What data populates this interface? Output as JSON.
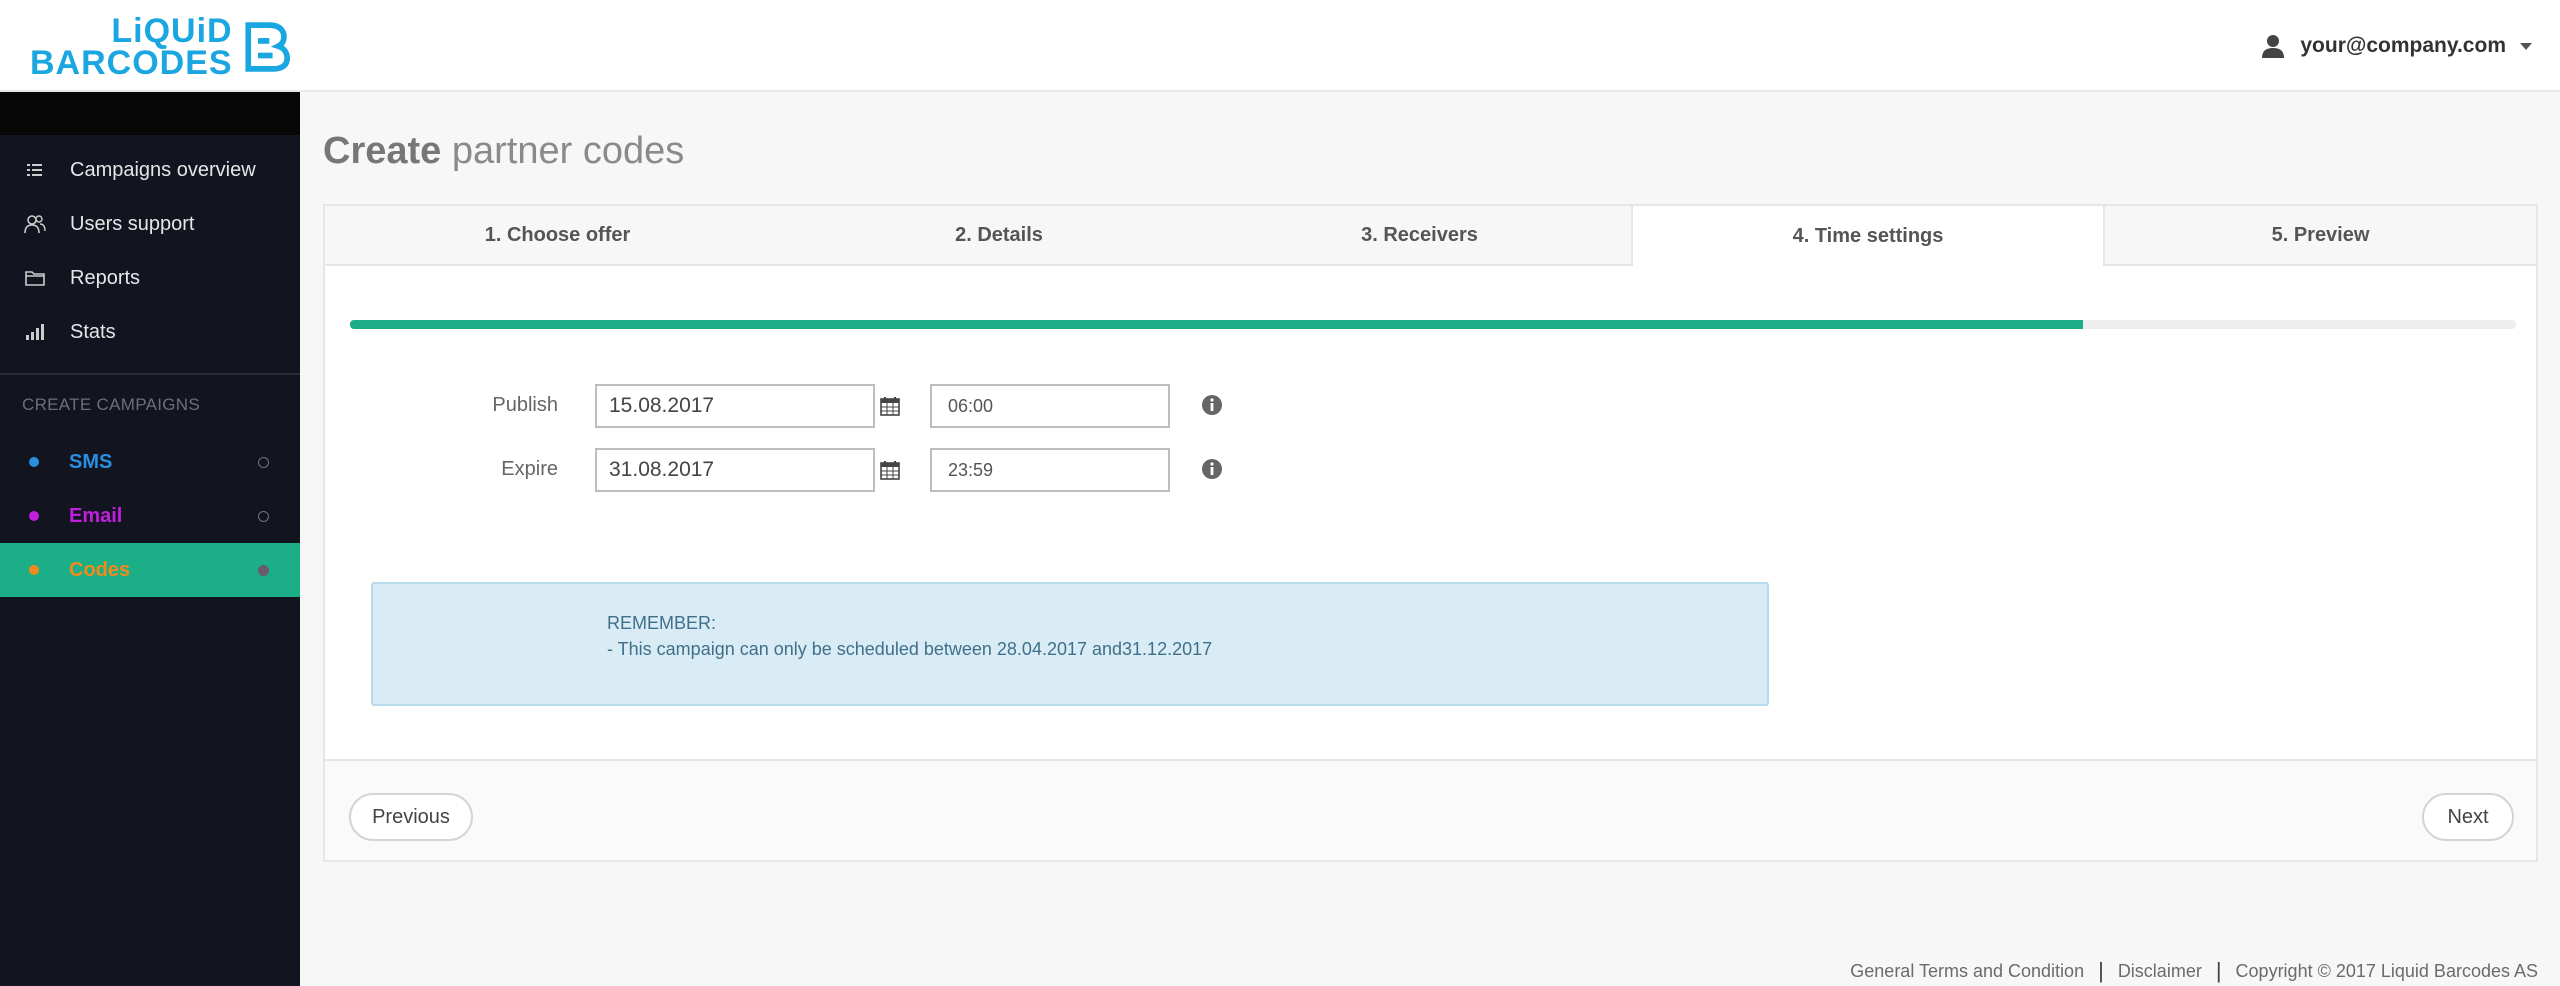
{
  "header": {
    "logo_line1": "LiQUiD",
    "logo_line2": "BARCODES",
    "user_email": "your@company.com",
    "brand_color": "#1aa6e0"
  },
  "sidebar": {
    "items": [
      {
        "label": "Campaigns overview",
        "icon": "list-icon"
      },
      {
        "label": "Users support",
        "icon": "users-icon"
      },
      {
        "label": "Reports",
        "icon": "folder-icon"
      },
      {
        "label": "Stats",
        "icon": "bar-chart-icon"
      }
    ],
    "section_label": "CREATE CAMPAIGNS",
    "campaigns": [
      {
        "label": "SMS",
        "color": "#2a8fe0"
      },
      {
        "label": "Email",
        "color": "#c21ee0"
      },
      {
        "label": "Codes",
        "color": "#f08a1a",
        "active": true
      }
    ],
    "active_color": "#1caf87"
  },
  "main": {
    "title_bold": "Create",
    "title_rest": " partner codes",
    "tabs": [
      {
        "label": "1. Choose offer"
      },
      {
        "label": "2. Details"
      },
      {
        "label": "3. Receivers"
      },
      {
        "label": "4. Time settings",
        "active": true
      },
      {
        "label": "5. Preview"
      }
    ],
    "progress_percent": 80,
    "publish": {
      "label": "Publish",
      "date": "15.08.2017",
      "time": "06:00"
    },
    "expire": {
      "label": "Expire",
      "date": "31.08.2017",
      "time": "23:59"
    },
    "notice": {
      "line1": "REMEMBER:",
      "line2": "- This campaign can only be scheduled between 28.04.2017 and31.12.2017"
    },
    "prev_label": "Previous",
    "next_label": "Next"
  },
  "footer": {
    "terms": "General Terms and Condition",
    "disclaimer": "Disclaimer",
    "copyright": "Copyright © 2017 Liquid Barcodes AS"
  }
}
